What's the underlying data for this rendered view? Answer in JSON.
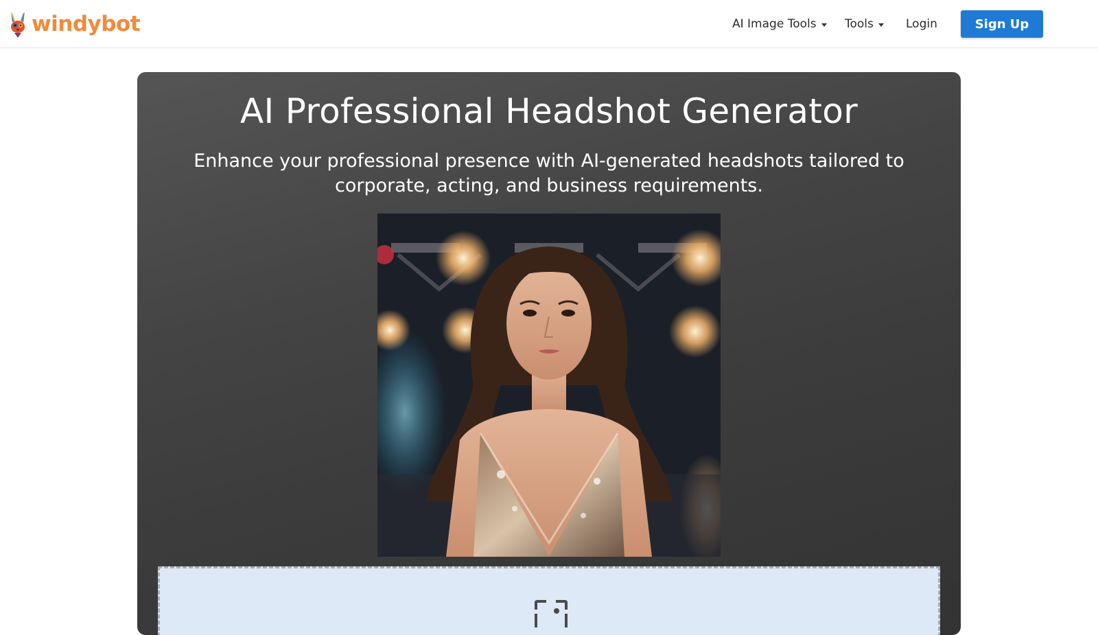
{
  "nav": {
    "brand": "windybot",
    "brand_icon": "rabbit-logo-icon",
    "ai_image_tools": "AI Image Tools",
    "tools": "Tools",
    "login": "Login",
    "signup": "Sign Up"
  },
  "hero": {
    "title": "AI Professional Headshot Generator",
    "subtitle": "Enhance your professional presence with AI-generated headshots tailored to corporate, acting, and business requirements.",
    "image_icon": "headshot-sample-image",
    "upload_icon": "image-upload-icon"
  },
  "colors": {
    "brand": "#f28a3c",
    "primary": "#1f7ad6",
    "hero_bg": "#444444",
    "upload_bg": "#dde9f6"
  }
}
